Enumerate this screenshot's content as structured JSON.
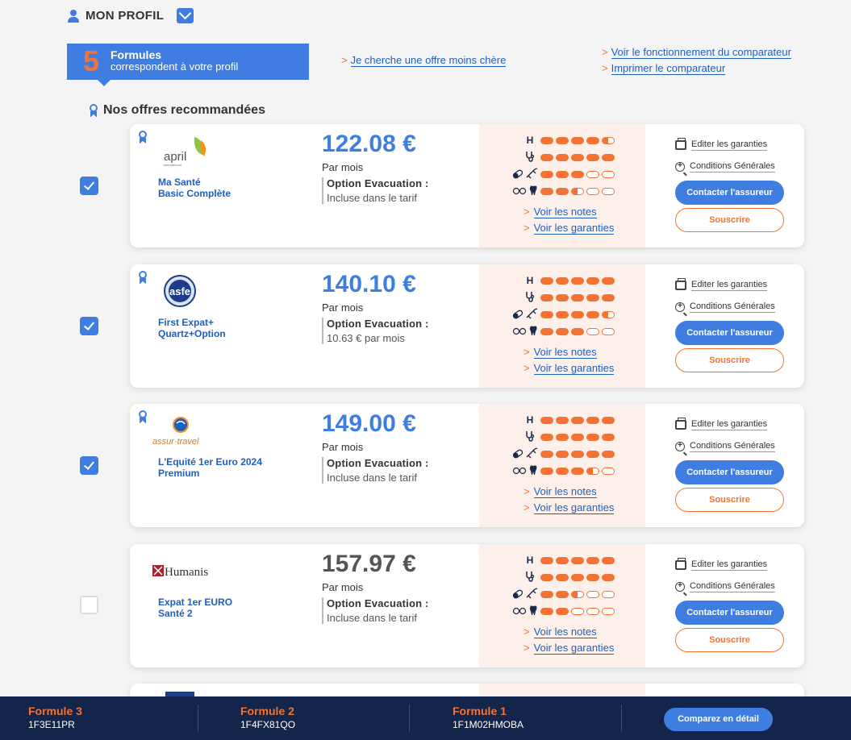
{
  "profile": {
    "title": "MON PROFIL"
  },
  "banner": {
    "count": "5",
    "line1": "Formules",
    "line2": "correspondent à votre profil"
  },
  "links": {
    "cheaper": "Je cherche une offre moins chère",
    "how": "Voir le fonctionnement du comparateur",
    "print": "Imprimer le comparateur",
    "arrow": ">"
  },
  "reco_title": "Nos offres recommandées",
  "offers": [
    {
      "insurer": "April",
      "logo_text": "april",
      "logo_sub": "international",
      "name": "Ma Santé\nBasic Complète",
      "name1": "Ma Santé",
      "name2": "Basic Complète",
      "price": "122.08 €",
      "period": "Par mois",
      "option_title": "Option Evacuation :",
      "option_value": "Incluse dans le tarif",
      "recommended": true,
      "checked": true,
      "ratings": [
        4.5,
        5,
        3,
        2.5
      ]
    },
    {
      "insurer": "ASFE",
      "logo_text": "asfe",
      "name1": "First Expat+",
      "name2": "Quartz+Option",
      "price": "140.10 €",
      "period": "Par mois",
      "option_title": "Option Evacuation :",
      "option_value": "10.63 € par mois",
      "recommended": true,
      "checked": true,
      "ratings": [
        5,
        5,
        4.5,
        3
      ]
    },
    {
      "insurer": "Assur-Travel",
      "logo_text": "assur·travel",
      "name1": "L'Equité 1er Euro 2024",
      "name2": "Premium",
      "price": "149.00 €",
      "period": "Par mois",
      "option_title": "Option Evacuation :",
      "option_value": "Incluse dans le tarif",
      "recommended": true,
      "checked": true,
      "ratings": [
        5,
        5,
        5,
        3.5
      ]
    },
    {
      "insurer": "Humanis",
      "logo_text": "Humanis",
      "name1": "Expat 1er EURO",
      "name2": "Santé 2",
      "price": "157.97 €",
      "period": "Par mois",
      "option_title": "Option Evacuation :",
      "option_value": "Incluse dans le tarif",
      "recommended": false,
      "checked": false,
      "ratings": [
        5,
        5,
        2.5,
        2
      ]
    }
  ],
  "rating_icons": {
    "hospital": "H",
    "doctor": "stethoscope-icon",
    "pharmacy": "pill-syringe-icon",
    "optical_dental": "glasses-tooth-icon"
  },
  "card_links": {
    "notes": "Voir les notes",
    "garanties": "Voir les garanties"
  },
  "card_actions": {
    "edit": "Editer les garanties",
    "conditions": "Conditions Générales",
    "contact": "Contacter l'assureur",
    "subscribe": "Souscrire"
  },
  "footer": {
    "items": [
      {
        "label": "Formule 3",
        "code": "1F3E11PR"
      },
      {
        "label": "Formule 2",
        "code": "1F4FX81QO"
      },
      {
        "label": "Formule 1",
        "code": "1F1M02HMOBA"
      }
    ],
    "compare": "Comparez en détail"
  },
  "colors": {
    "blue": "#3f7ee0",
    "orange": "#f37335",
    "navy": "#13254a"
  }
}
